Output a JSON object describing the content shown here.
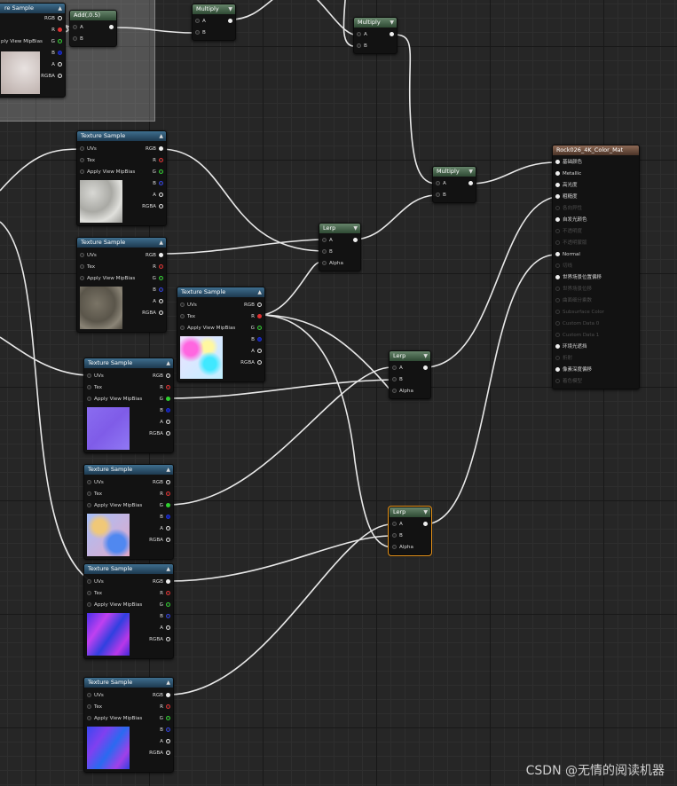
{
  "comment_node": {
    "title": "re Sample",
    "outputs": [
      "RGB",
      "R",
      "G",
      "B",
      "A",
      "RGBA"
    ],
    "inputs": [
      "ply View MipBias"
    ]
  },
  "add_node": {
    "title": "Add(,0.5)",
    "inputs": [
      "A",
      "B"
    ]
  },
  "multiply_1": {
    "title": "Multiply",
    "inputs": [
      "A",
      "B"
    ]
  },
  "multiply_2": {
    "title": "Multiply",
    "inputs": [
      "A",
      "B"
    ]
  },
  "multiply_3": {
    "title": "Multiply",
    "inputs": [
      "A",
      "B"
    ]
  },
  "texture_sample": {
    "title": "Texture Sample",
    "inputs": [
      "UVs",
      "Tex",
      "Apply View MipBias"
    ],
    "outputs": [
      "RGB",
      "R",
      "G",
      "B",
      "A",
      "RGBA"
    ]
  },
  "lerp": {
    "title": "Lerp",
    "inputs": [
      "A",
      "B",
      "Alpha"
    ]
  },
  "material_node": {
    "title": "Rock026_4K_Color_Mat",
    "pins": [
      {
        "label": "基础颜色",
        "enabled": true
      },
      {
        "label": "Metallic",
        "enabled": true
      },
      {
        "label": "高光度",
        "enabled": true
      },
      {
        "label": "粗糙度",
        "enabled": true
      },
      {
        "label": "各向异性",
        "enabled": false
      },
      {
        "label": "自发光颜色",
        "enabled": true
      },
      {
        "label": "不透明度",
        "enabled": false
      },
      {
        "label": "不透明蒙版",
        "enabled": false
      },
      {
        "label": "Normal",
        "enabled": true
      },
      {
        "label": "切线",
        "enabled": false
      },
      {
        "label": "世界场景位置偏移",
        "enabled": true
      },
      {
        "label": "世界场景位移",
        "enabled": false
      },
      {
        "label": "曲面细分乘数",
        "enabled": false
      },
      {
        "label": "Subsurface Color",
        "enabled": false
      },
      {
        "label": "Custom Data 0",
        "enabled": false
      },
      {
        "label": "Custom Data 1",
        "enabled": false
      },
      {
        "label": "环境光遮挡",
        "enabled": true
      },
      {
        "label": "折射",
        "enabled": false
      },
      {
        "label": "像素深度偏移",
        "enabled": true
      },
      {
        "label": "着色模型",
        "enabled": false
      }
    ]
  },
  "watermark": "CSDN @无情的阅读机器",
  "colors": {
    "tex_header": "#2b5470",
    "math_header": "#4a6a4e",
    "material_header": "#6b4a3a",
    "selected_outline": "#e8941a"
  }
}
